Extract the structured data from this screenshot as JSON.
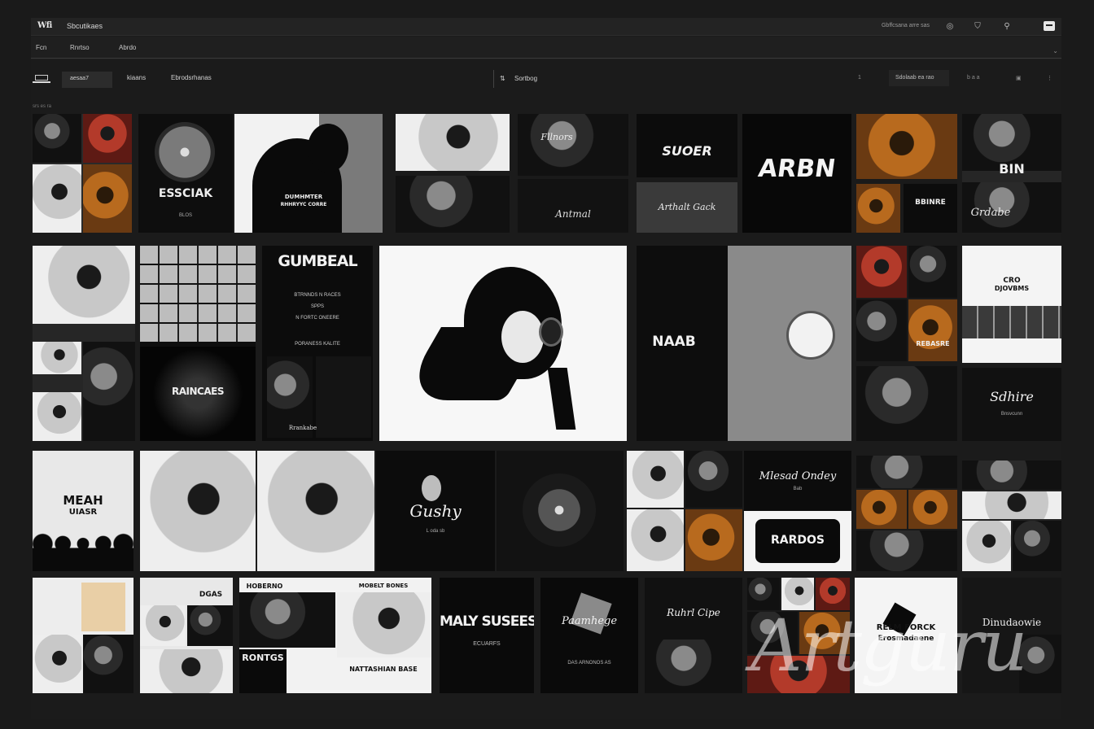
{
  "titlebar": {
    "logo": "Wfi",
    "app_name": "Sbcutikaes",
    "account": "Gbffcsana arre sas",
    "icons": [
      "circle-icon",
      "shield-icon",
      "pin-icon",
      "window-icon"
    ]
  },
  "menu": {
    "items": [
      "Fcn",
      "Rnrtso",
      "Abrdo"
    ]
  },
  "toolbar": {
    "select_value": "aesaa7",
    "labels": [
      "kiaans",
      "Ebrodsrhanas"
    ],
    "sort_label": "Sortbog",
    "ctrl_left": "1",
    "ctrl_box": "Sdolaab ea rao",
    "ctrl_right": "b a a",
    "caption": "srs es ra"
  },
  "tiles": {
    "t2": {
      "title": "ESSCIAK",
      "sub": "BLOS"
    },
    "t3": {
      "line1": "DUMHMTER",
      "line2": "RHHRYYC CORRE"
    },
    "t5": {
      "top": "Fllnors",
      "bottom": "Antmal"
    },
    "t6": {
      "top": "SUOER",
      "bottom": "Arthalt Gack"
    },
    "t7": {
      "title": "ARBN"
    },
    "t8": {
      "a": "BIN",
      "b": "BBINRE",
      "c": "Grdabe"
    },
    "t9": {
      "title": "RAINCAES"
    },
    "t11": {
      "title": "GUMBEAL",
      "lines": [
        "BTRNNDS N RACES",
        "SPPS",
        "N FORTC ONEERE",
        "PORANESS KALITE"
      ],
      "bottom": "Rrankabe"
    },
    "t13": {
      "title": "NAAB"
    },
    "t14": {
      "title": "REBASRE"
    },
    "t15": {
      "title": "CRO",
      "sub": "DJOVBMS"
    },
    "t16": {
      "title": "Sdhire",
      "sub": "Bnsvcunn"
    },
    "t17": {
      "title": "MEAH",
      "sub": "UIASR"
    },
    "t19": {
      "title": "Gushy",
      "sub": "L oda sb"
    },
    "t21": {
      "title": "Mlesad Ondey",
      "sub": "Bab"
    },
    "t22": {
      "title": "RARDOS"
    },
    "t25": {
      "title": "DGAS"
    },
    "t26": {
      "title": "RONTGS",
      "header": "HOBERNO",
      "right": "MOBELT BONES",
      "bottom": "NATTASHIAN BASE"
    },
    "t27": {
      "title": "MALY SUSEES",
      "sub": "ECUARFS"
    },
    "t28": {
      "title": "Paamhege",
      "sub": "DAS ARNONOS AS"
    },
    "t29": {
      "title": "Ruhrl Cipe"
    },
    "t31": {
      "title": "RELM FORCK",
      "sub": "Erosmadaene"
    },
    "t32": {
      "title": "Dinudaowie"
    }
  },
  "watermark": "Artguru"
}
